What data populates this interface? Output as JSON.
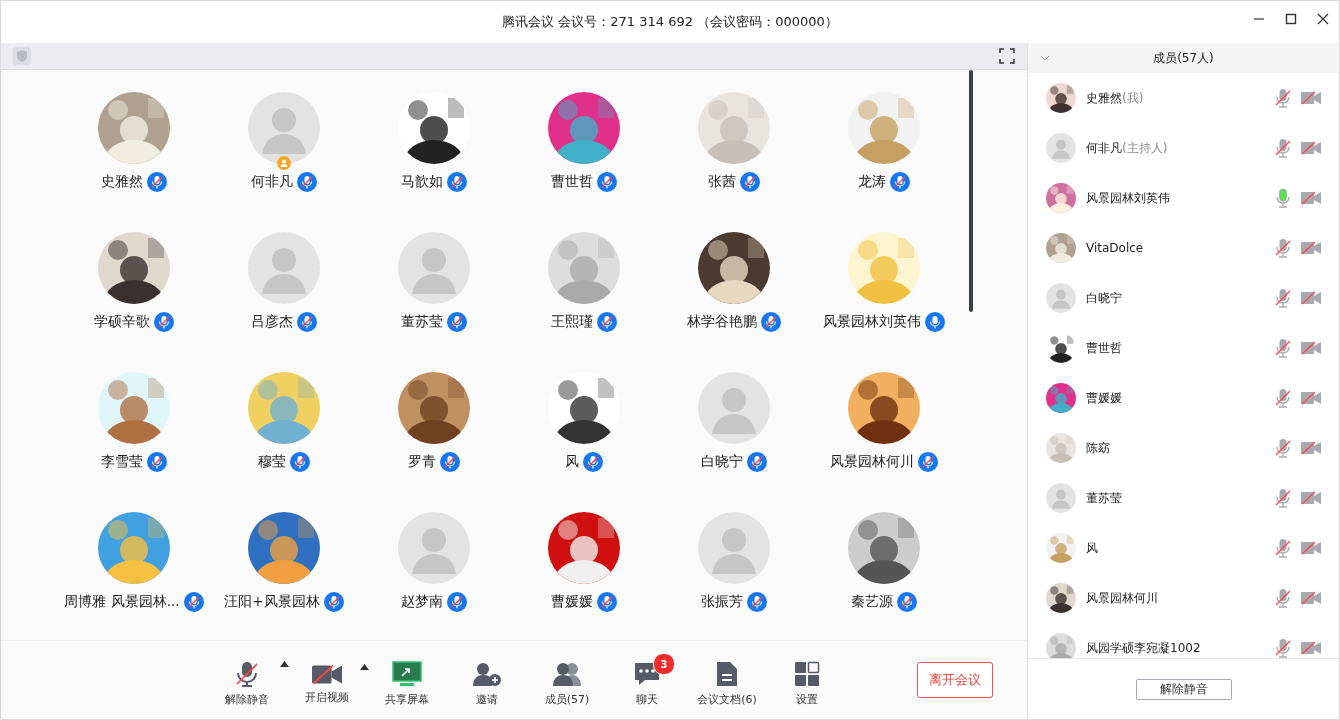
{
  "window": {
    "title": "腾讯会议 会议号：271 314 692 （会议密码：000000）"
  },
  "participants": [
    {
      "name": "史雅然",
      "muted": true,
      "photo": true,
      "host": false
    },
    {
      "name": "何非凡",
      "muted": true,
      "photo": false,
      "host": true
    },
    {
      "name": "马歆如",
      "muted": true,
      "photo": true,
      "host": false
    },
    {
      "name": "曹世哲",
      "muted": true,
      "photo": true,
      "host": false
    },
    {
      "name": "张茜",
      "muted": true,
      "photo": true,
      "host": false
    },
    {
      "name": "龙涛",
      "muted": true,
      "photo": true,
      "host": false
    },
    {
      "name": "学硕辛歌",
      "muted": true,
      "photo": true,
      "host": false
    },
    {
      "name": "吕彦杰",
      "muted": true,
      "photo": false,
      "host": false
    },
    {
      "name": "董苏莹",
      "muted": true,
      "photo": false,
      "host": false
    },
    {
      "name": "王熙瑾",
      "muted": true,
      "photo": true,
      "host": false
    },
    {
      "name": "林学谷艳鹏",
      "muted": true,
      "photo": true,
      "host": false
    },
    {
      "name": "风景园林刘英伟",
      "muted": false,
      "photo": true,
      "host": false
    },
    {
      "name": "李雪莹",
      "muted": true,
      "photo": true,
      "host": false
    },
    {
      "name": "穆莹",
      "muted": true,
      "photo": true,
      "host": false
    },
    {
      "name": "罗青",
      "muted": true,
      "photo": true,
      "host": false
    },
    {
      "name": "风",
      "muted": true,
      "photo": true,
      "host": false
    },
    {
      "name": "白晓宁",
      "muted": true,
      "photo": false,
      "host": false
    },
    {
      "name": "风景园林何川",
      "muted": true,
      "photo": true,
      "host": false
    },
    {
      "name": "周博雅 风景园林...",
      "muted": true,
      "photo": true,
      "host": false
    },
    {
      "name": "汪阳+风景园林",
      "muted": true,
      "photo": true,
      "host": false
    },
    {
      "name": "赵梦南",
      "muted": true,
      "photo": false,
      "host": false
    },
    {
      "name": "曹媛媛",
      "muted": true,
      "photo": true,
      "host": false
    },
    {
      "name": "张振芳",
      "muted": true,
      "photo": false,
      "host": false
    },
    {
      "name": "秦艺源",
      "muted": true,
      "photo": true,
      "host": false
    }
  ],
  "toolbar": [
    {
      "kind": "mic",
      "label": "解除静音",
      "caret": true
    },
    {
      "kind": "video",
      "label": "开启视频",
      "caret": true
    },
    {
      "kind": "share",
      "label": "共享屏幕",
      "caret": false
    },
    {
      "kind": "invite",
      "label": "邀请",
      "caret": false
    },
    {
      "kind": "members",
      "label": "成员(57)",
      "caret": false
    },
    {
      "kind": "chat",
      "label": "聊天",
      "caret": false,
      "badge": "3"
    },
    {
      "kind": "docs",
      "label": "会议文档(6)",
      "caret": false
    },
    {
      "kind": "settings",
      "label": "设置",
      "caret": false
    }
  ],
  "leave_button": "离开会议",
  "members_panel": {
    "title": "成员(57人)",
    "members": [
      {
        "name": "史雅然",
        "suffix": "(我)",
        "photo": true,
        "muted": true
      },
      {
        "name": "何非凡",
        "suffix": "(主持人)",
        "photo": false,
        "muted": true
      },
      {
        "name": "风景园林刘英伟",
        "photo": true,
        "muted": false
      },
      {
        "name": "VitaDolce",
        "photo": true,
        "muted": true
      },
      {
        "name": "白晓宁",
        "photo": false,
        "muted": true
      },
      {
        "name": "曹世哲",
        "photo": true,
        "muted": true
      },
      {
        "name": "曹媛媛",
        "photo": true,
        "muted": true
      },
      {
        "name": "陈窈",
        "photo": true,
        "muted": true
      },
      {
        "name": "董苏莹",
        "photo": false,
        "muted": true
      },
      {
        "name": "风",
        "photo": true,
        "muted": true
      },
      {
        "name": "风景园林何川",
        "photo": true,
        "muted": true
      },
      {
        "name": "风园学硕李宛凝1002",
        "photo": true,
        "muted": true
      }
    ],
    "mute_button": "解除静音"
  }
}
